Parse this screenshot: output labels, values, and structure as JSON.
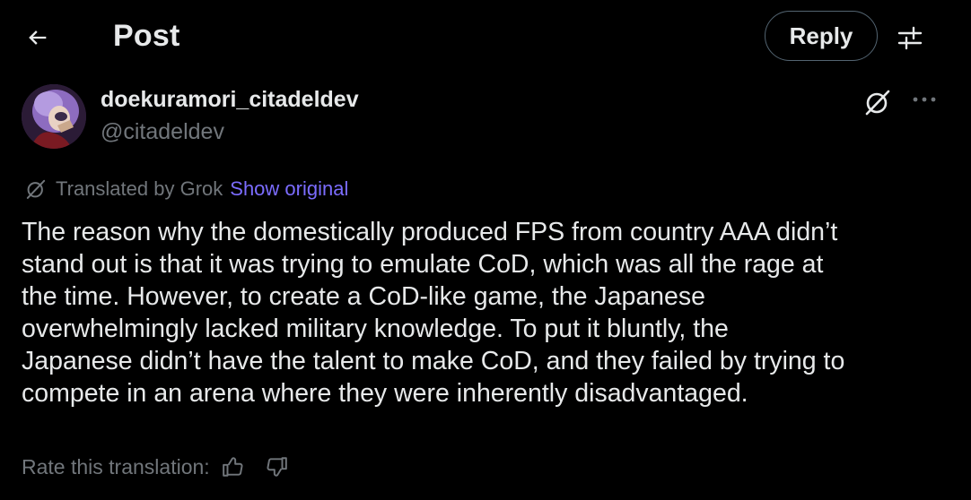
{
  "header": {
    "title": "Post",
    "reply_label": "Reply"
  },
  "author": {
    "display_name": "doekuramori_citadeldev",
    "handle": "@citadeldev"
  },
  "translation": {
    "label": "Translated by Grok",
    "show_original": "Show original"
  },
  "post": {
    "text": "The reason why the domestically produced FPS from country AAA didn’t\nstand out is that it was trying to emulate CoD, which was all the rage at\nthe time. However, to create a CoD-like game, the Japanese\noverwhelmingly lacked military knowledge. To put it bluntly, the\nJapanese didn’t have the talent to make CoD, and they failed by trying to\ncompete in an arena where they were inherently disadvantaged."
  },
  "rating": {
    "label": "Rate this translation:"
  },
  "icons": {
    "back": "arrow-left-icon",
    "settings": "sliders-icon",
    "grok": "grok-icon",
    "more": "more-horizontal-icon",
    "thumb_up": "thumb-up-icon",
    "thumb_down": "thumb-down-icon"
  },
  "colors": {
    "background": "#000000",
    "text_primary": "#e7e9ea",
    "text_secondary": "#71767b",
    "link": "#7b6cff",
    "border": "#536471"
  }
}
